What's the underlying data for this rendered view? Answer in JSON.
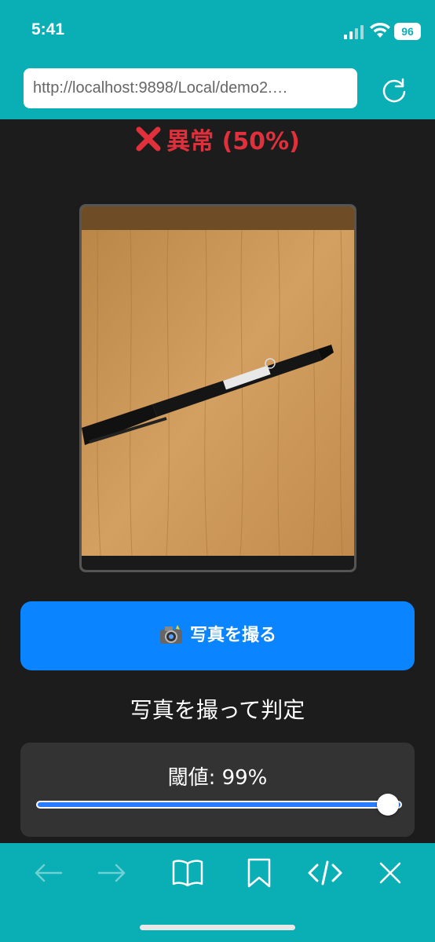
{
  "status_bar": {
    "time": "5:41",
    "battery": "96"
  },
  "browser": {
    "url": "http://localhost:9898/Local/demo2.…"
  },
  "result": {
    "text": "異常 (50%)",
    "status_color": "#e0303b"
  },
  "photo": {
    "description_icon": "pen-on-wood-photo"
  },
  "capture": {
    "button_label": "写真を撮る"
  },
  "prompt": {
    "text": "写真を撮って判定"
  },
  "threshold": {
    "label": "閾値: 99%",
    "value": 0.99
  },
  "toolbar": {
    "icons": [
      "back-icon",
      "forward-icon",
      "book-icon",
      "bookmark-icon",
      "code-icon",
      "close-icon"
    ]
  },
  "colors": {
    "accent": "#0aaeb5",
    "button": "#0a84ff",
    "background": "#1c1c1c"
  }
}
